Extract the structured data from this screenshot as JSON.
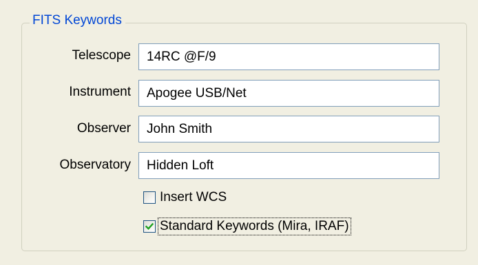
{
  "group": {
    "title": "FITS Keywords"
  },
  "fields": [
    {
      "label": "Telescope",
      "value": "14RC @F/9"
    },
    {
      "label": "Instrument",
      "value": "Apogee USB/Net"
    },
    {
      "label": "Observer",
      "value": "John Smith"
    },
    {
      "label": "Observatory",
      "value": "Hidden Loft"
    }
  ],
  "checkboxes": [
    {
      "label": "Insert WCS",
      "checked": false
    },
    {
      "label": "Standard Keywords (Mira, IRAF)",
      "checked": true
    }
  ],
  "colors": {
    "background": "#f1efe2",
    "group_title": "#0046d5",
    "input_border": "#7f9db9",
    "checkbox_border": "#1c5180",
    "check_mark": "#21a121"
  }
}
